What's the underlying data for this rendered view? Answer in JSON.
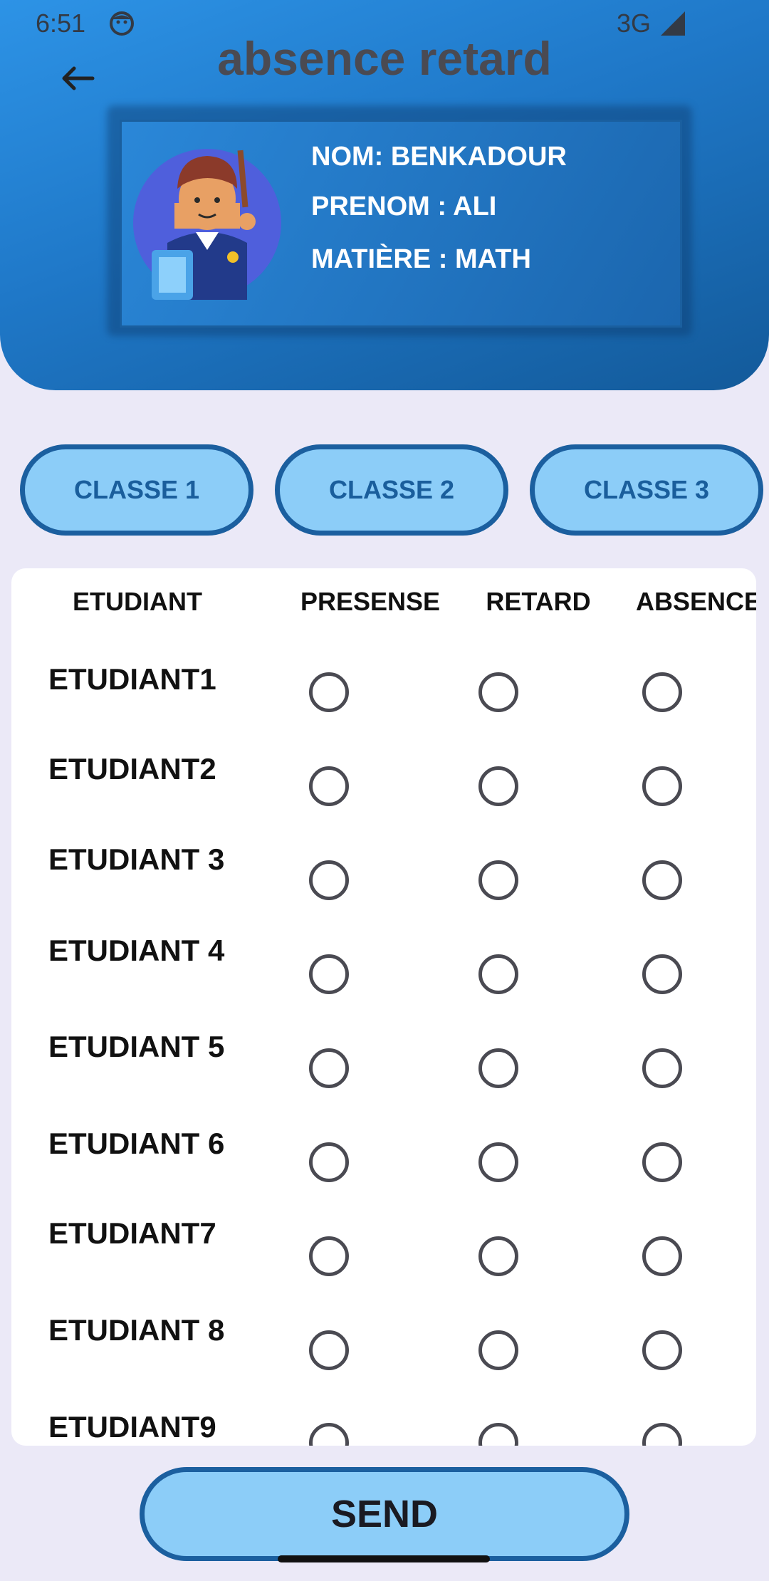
{
  "status_bar": {
    "time": "6:51",
    "network": "3G"
  },
  "header": {
    "title": "absence retard"
  },
  "teacher": {
    "nom": "NOM: BENKADOUR",
    "prenom": "PRENOM : ALI",
    "matiere": "MATIÈRE : MATH"
  },
  "classes": [
    "CLASSE 1",
    "CLASSE 2",
    "CLASSE 3"
  ],
  "table": {
    "headers": [
      "ETUDIANT",
      "PRESENSE",
      "RETARD",
      "ABSENCE"
    ],
    "students": [
      "ETUDIANT1",
      "ETUDIANT2",
      "ETUDIANT 3",
      "ETUDIANT 4",
      "ETUDIANT 5",
      "ETUDIANT 6",
      "ETUDIANT7",
      "ETUDIANT 8",
      "ETUDIANT9"
    ]
  },
  "send_label": "SEND",
  "colors": {
    "header_blue": "#2d93e6",
    "button_fill": "#8ccdf8",
    "button_border": "#1b5f9f"
  }
}
